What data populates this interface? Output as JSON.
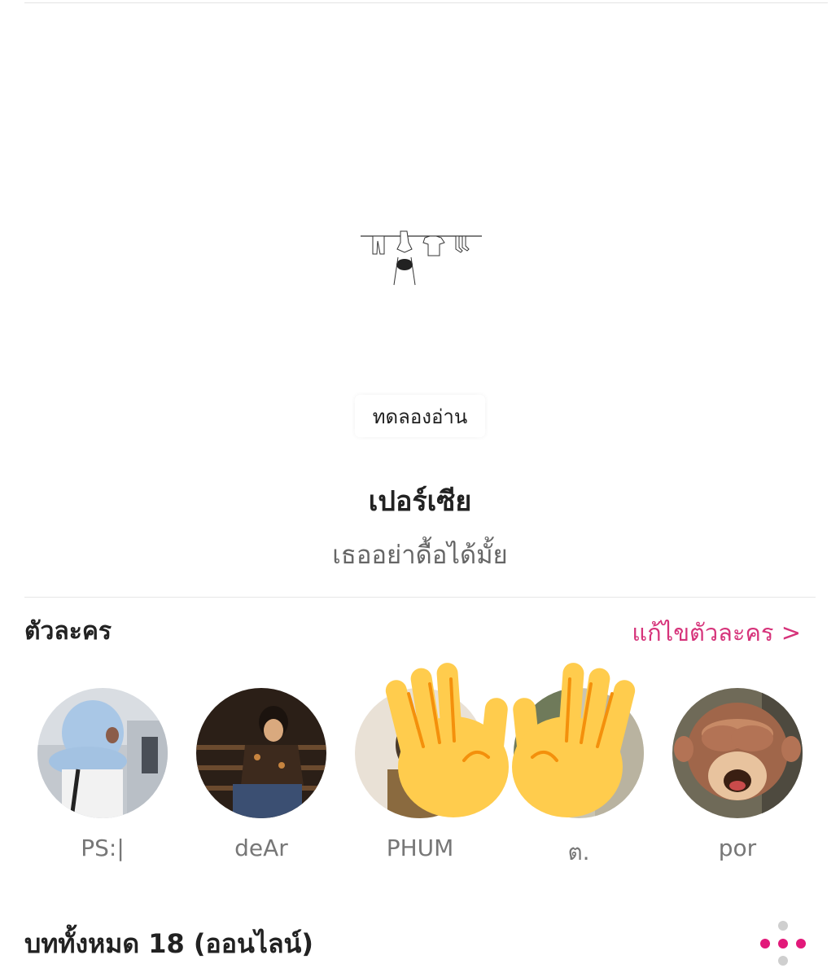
{
  "preview": {
    "label": "ทดลองอ่าน"
  },
  "book": {
    "title": "เปอร์เซีย",
    "subtitle": "เธออย่าดื้อได้มั้ย"
  },
  "characters_section": {
    "title": "ตัวละคร",
    "edit_link": "แก้ไขตัวละคร >",
    "characters": [
      {
        "name": "PS:|"
      },
      {
        "name": "deAr"
      },
      {
        "name": "PHUM"
      },
      {
        "name": "ต."
      },
      {
        "name": "por"
      }
    ]
  },
  "chapters": {
    "title": "บททั้งหมด 18 (ออนไลน์)"
  },
  "colors": {
    "accent": "#d6337a",
    "emoji_yellow": "#ffd54f"
  }
}
